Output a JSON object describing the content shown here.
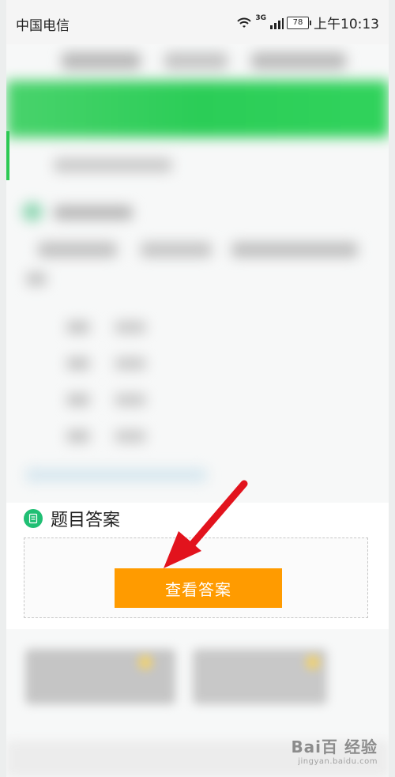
{
  "status_bar": {
    "carrier": "中国电信",
    "network_tag": "3G",
    "battery_level": "78",
    "time": "上午10:13"
  },
  "answer_section": {
    "title": "题目答案",
    "button_label": "查看答案"
  },
  "watermark": {
    "text": "Bai百 经验",
    "url": "jingyan.baidu.com"
  },
  "colors": {
    "green_banner": "#2bcd57",
    "orange_button": "#ff9b00",
    "doc_icon": "#20bf74",
    "arrow_red": "#e2131d"
  },
  "icons": {
    "doc": "bookmark-doc-icon",
    "wifi": "wifi-icon",
    "signal": "signal-bars-icon",
    "battery": "battery-icon",
    "arrow": "red-arrow-icon"
  }
}
